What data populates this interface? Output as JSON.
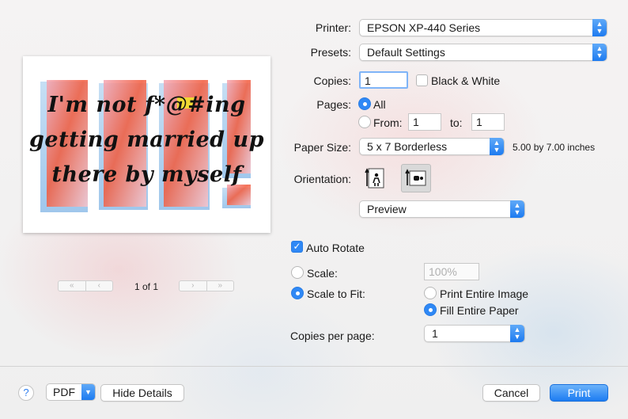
{
  "printer": {
    "label": "Printer:",
    "value": "EPSON XP-440 Series"
  },
  "presets": {
    "label": "Presets:",
    "value": "Default Settings"
  },
  "copies": {
    "label": "Copies:",
    "value": "1",
    "bw_label": "Black & White"
  },
  "pages": {
    "label": "Pages:",
    "all_label": "All",
    "from_label": "From:",
    "from_value": "1",
    "to_label": "to:",
    "to_value": "1"
  },
  "paper_size": {
    "label": "Paper Size:",
    "value": "5 x 7 Borderless",
    "dimensions": "5.00 by 7.00 inches"
  },
  "orientation": {
    "label": "Orientation:"
  },
  "section_popup": {
    "value": "Preview"
  },
  "auto_rotate": {
    "label": "Auto Rotate",
    "checked": true
  },
  "scale": {
    "label": "Scale:",
    "placeholder": "100%"
  },
  "scale_to_fit": {
    "label": "Scale to Fit:",
    "print_entire": "Print Entire Image",
    "fill_entire": "Fill Entire Paper",
    "selected": "fill_entire"
  },
  "copies_per_page": {
    "label": "Copies per page:",
    "value": "1"
  },
  "preview": {
    "backdrop_text": "DUH!",
    "lines": [
      "I'm not f*@#ing",
      "getting married up",
      "there by myself"
    ],
    "page_indicator": "1 of 1",
    "nav": {
      "first": "«",
      "prev": "‹",
      "next": "›",
      "last": "»"
    }
  },
  "footer": {
    "help_label": "?",
    "pdf_label": "PDF",
    "hide_details_label": "Hide Details",
    "cancel_label": "Cancel",
    "print_label": "Print"
  },
  "colors": {
    "accent": "#2f88f5",
    "primary_button": "#1c7cf2",
    "art_red": "#f2553a",
    "art_blue": "#9cc6ee"
  }
}
